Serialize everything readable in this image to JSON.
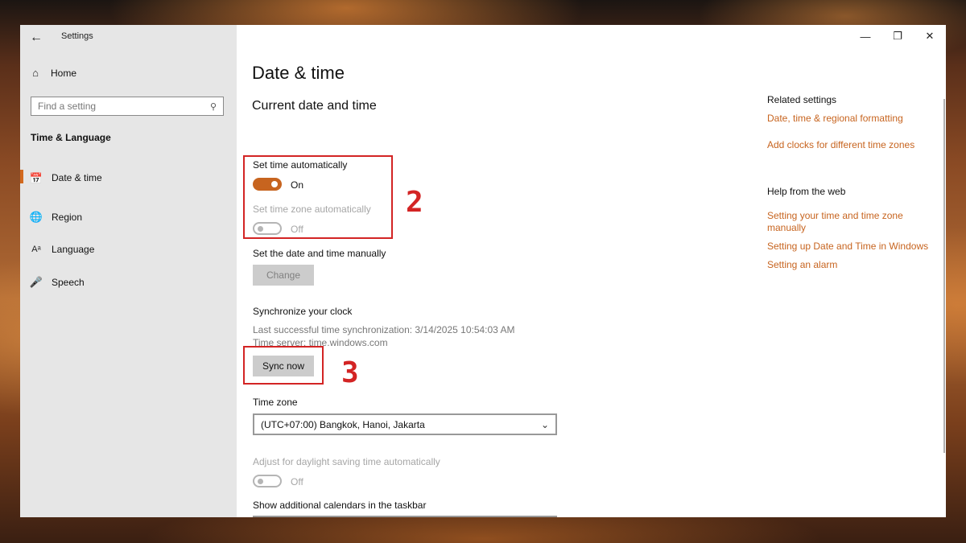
{
  "window": {
    "title": "Settings"
  },
  "sidebar": {
    "home": "Home",
    "search_placeholder": "Find a setting",
    "section": "Time & Language",
    "items": [
      {
        "label": "Date & time",
        "icon": "calendar-clock-icon",
        "active": true
      },
      {
        "label": "Region",
        "icon": "globe-icon",
        "active": false
      },
      {
        "label": "Language",
        "icon": "language-icon",
        "active": false
      },
      {
        "label": "Speech",
        "icon": "microphone-icon",
        "active": false
      }
    ]
  },
  "page": {
    "title": "Date & time",
    "subtitle": "Current date and time",
    "set_time_auto": {
      "label": "Set time automatically",
      "state": "On"
    },
    "set_tz_auto": {
      "label": "Set time zone automatically",
      "state": "Off"
    },
    "manual": {
      "label": "Set the date and time manually",
      "button": "Change"
    },
    "sync": {
      "label": "Synchronize your clock",
      "last_sync": "Last successful time synchronization: 3/14/2025 10:54:03 AM",
      "server": "Time server: time.windows.com",
      "button": "Sync now"
    },
    "timezone": {
      "label": "Time zone",
      "value": "(UTC+07:00) Bangkok, Hanoi, Jakarta"
    },
    "dst": {
      "label": "Adjust for daylight saving time automatically",
      "state": "Off"
    },
    "calendars": {
      "label": "Show additional calendars in the taskbar"
    }
  },
  "related": {
    "heading": "Related settings",
    "links": [
      "Date, time & regional formatting",
      "Add clocks for different time zones"
    ],
    "help_heading": "Help from the web",
    "help_links": [
      "Setting your time and time zone manually",
      "Setting up Date and Time in Windows",
      "Setting an alarm"
    ]
  },
  "annotations": {
    "first": "2",
    "second": "3"
  },
  "colors": {
    "accent": "#c7641f",
    "annotation": "#d32424"
  }
}
